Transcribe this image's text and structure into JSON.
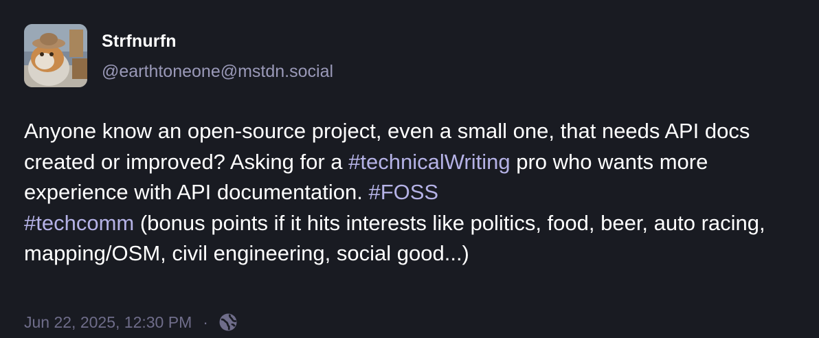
{
  "author": {
    "display_name": "Strfnurfn",
    "handle": "@earthtoneone@mstdn.social",
    "avatar_icon": "cat-wearing-cowboy-hat-avatar"
  },
  "content": {
    "part1": "Anyone know an open-source project, even a small one, that needs API docs created or improved? Asking for a ",
    "hashtag1": "#technicalWriting",
    "part2": " pro who wants more experience with API documentation. ",
    "hashtag2": "#FOSS",
    "hashtag3": "#techcomm",
    "part3": " (bonus points if it hits interests like politics, food, beer, auto racing, mapping/OSM, civil engineering, social good...)"
  },
  "meta": {
    "timestamp": "Jun 22, 2025, 12:30 PM",
    "separator": "·",
    "visibility_icon": "globe-icon"
  },
  "colors": {
    "background": "#191b22",
    "text": "#ffffff",
    "handle": "#9a99b8",
    "hashtag": "#b5b2e6",
    "meta": "#6f6d8a"
  }
}
